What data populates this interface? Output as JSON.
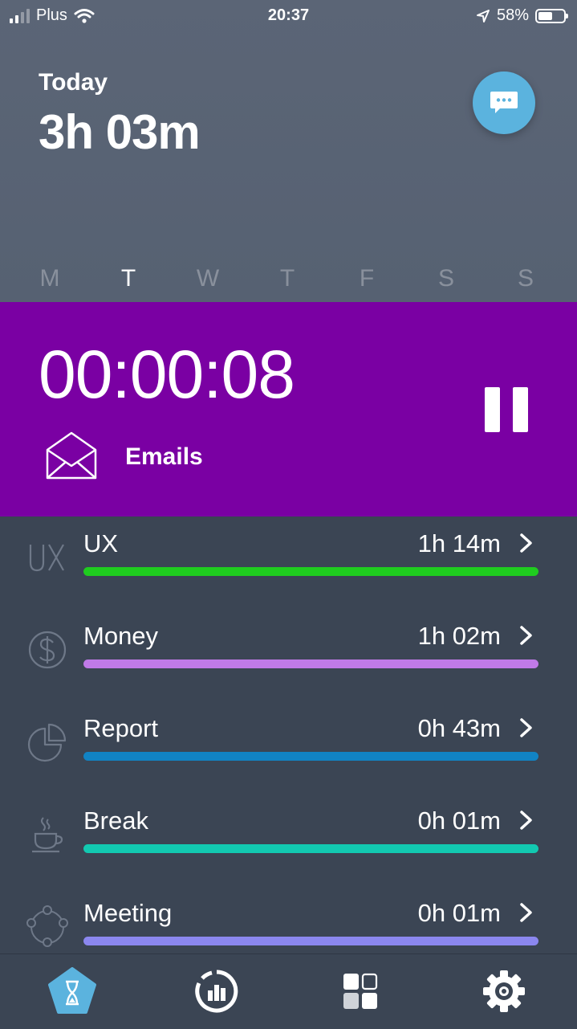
{
  "status_bar": {
    "carrier": "Plus",
    "time": "20:37",
    "battery": "58%",
    "battery_level": 0.58,
    "icons": [
      "signal-icon",
      "wifi-icon",
      "location-arrow-icon",
      "battery-icon"
    ]
  },
  "header": {
    "today_label": "Today",
    "today_total": "3h 03m",
    "chat_icon": "chat-bubble-icon",
    "days": [
      {
        "label": "M",
        "active": false
      },
      {
        "label": "T",
        "active": true
      },
      {
        "label": "W",
        "active": false
      },
      {
        "label": "T",
        "active": false
      },
      {
        "label": "F",
        "active": false
      },
      {
        "label": "S",
        "active": false
      },
      {
        "label": "S",
        "active": false
      }
    ]
  },
  "timer": {
    "value": "00:00:08",
    "task": "Emails",
    "task_icon": "envelope-icon",
    "control_icon": "pause-icon",
    "color": "#7a00a3"
  },
  "activities": [
    {
      "name": "UX",
      "time": "1h 14m",
      "icon": "ux-text-icon",
      "color": "#1fcc1f"
    },
    {
      "name": "Money",
      "time": "1h 02m",
      "icon": "dollar-coin-icon",
      "color": "#c07ae8"
    },
    {
      "name": "Report",
      "time": "0h 43m",
      "icon": "pie-chart-icon",
      "color": "#1183c4"
    },
    {
      "name": "Break",
      "time": "0h 01m",
      "icon": "coffee-cup-icon",
      "color": "#12c9b1"
    },
    {
      "name": "Meeting",
      "time": "0h 01m",
      "icon": "people-circle-icon",
      "color": "#8b87ef"
    }
  ],
  "tab_bar": {
    "tabs": [
      {
        "icon": "hourglass-icon",
        "active": true
      },
      {
        "icon": "stats-icon",
        "active": false
      },
      {
        "icon": "grid-icon",
        "active": false
      },
      {
        "icon": "settings-gear-icon",
        "active": false
      }
    ],
    "accent": "#5bb3de"
  }
}
